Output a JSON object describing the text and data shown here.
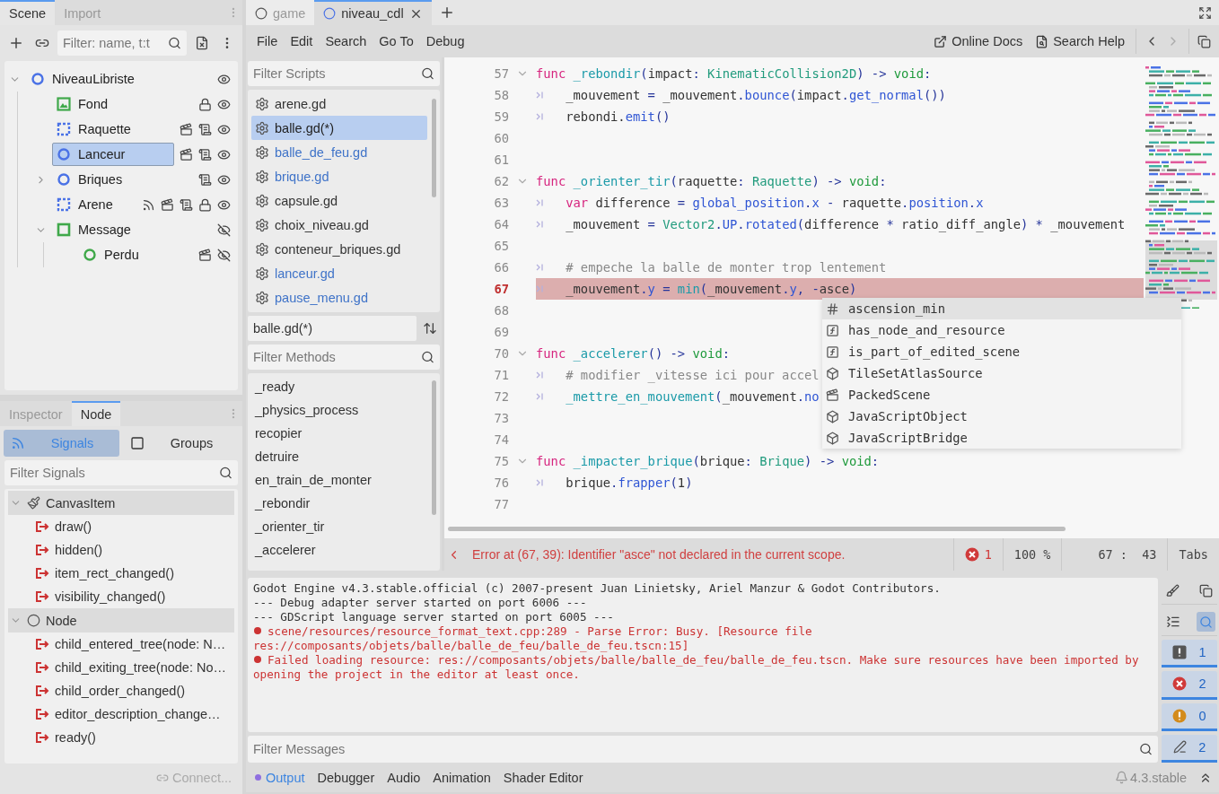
{
  "scene_dock": {
    "tabs": [
      {
        "label": "Scene",
        "selected": true
      },
      {
        "label": "Import",
        "selected": false
      }
    ],
    "filter": {
      "placeholder": "Filter: name, t:t"
    },
    "tree": [
      {
        "name": "NiveauLibriste",
        "kind": "circle",
        "color": "#4a72e6",
        "selected": false,
        "expanded": true,
        "badges": [
          {
            "kind": "visible"
          }
        ],
        "children": [
          {
            "name": "Fond",
            "kind": "image",
            "color": "#3fa84a",
            "selected": false,
            "badges": [
              {
                "kind": "lock"
              },
              {
                "kind": "visible"
              }
            ]
          },
          {
            "name": "Raquette",
            "kind": "dotted-square",
            "color": "#4a72e6",
            "selected": false,
            "badges": [
              {
                "kind": "scene"
              },
              {
                "kind": "script"
              },
              {
                "kind": "visible"
              }
            ]
          },
          {
            "name": "Lanceur",
            "kind": "circle",
            "color": "#4a72e6",
            "selected": true,
            "badges": [
              {
                "kind": "scene"
              },
              {
                "kind": "script"
              },
              {
                "kind": "visible"
              }
            ]
          },
          {
            "name": "Briques",
            "kind": "circle",
            "color": "#4a72e6",
            "selected": false,
            "expanded": false,
            "badges": [
              {
                "kind": "script"
              },
              {
                "kind": "visible"
              }
            ]
          },
          {
            "name": "Arene",
            "kind": "dotted-square",
            "color": "#4a72e6",
            "selected": false,
            "badges": [
              {
                "kind": "signal"
              },
              {
                "kind": "scene"
              },
              {
                "kind": "script"
              },
              {
                "kind": "lock"
              },
              {
                "kind": "visible"
              }
            ]
          },
          {
            "name": "Message",
            "kind": "square",
            "color": "#3fa84a",
            "selected": false,
            "expanded": true,
            "badges": [
              {
                "kind": "hidden"
              }
            ],
            "children": [
              {
                "name": "Perdu",
                "kind": "circle",
                "color": "#3fa84a",
                "selected": false,
                "badges": [
                  {
                    "kind": "scene"
                  },
                  {
                    "kind": "hidden"
                  }
                ]
              }
            ]
          }
        ]
      }
    ]
  },
  "node_dock": {
    "tabs": [
      {
        "label": "Inspector",
        "selected": false
      },
      {
        "label": "Node",
        "selected": true
      }
    ],
    "modes": [
      {
        "kind": "signals",
        "label": "Signals",
        "selected": true
      },
      {
        "kind": "groups",
        "label": "Groups",
        "selected": false
      }
    ],
    "filter": {
      "placeholder": "Filter Signals"
    },
    "groups": [
      {
        "name": "CanvasItem",
        "kind": "brush",
        "expanded": true,
        "signals": [
          "draw()",
          "hidden()",
          "item_rect_changed()",
          "visibility_changed()"
        ]
      },
      {
        "name": "Node",
        "kind": "circle",
        "expanded": true,
        "signals": [
          "child_entered_tree(node: N…",
          "child_exiting_tree(node: No…",
          "child_order_changed()",
          "editor_description_change…",
          "ready()"
        ]
      }
    ],
    "connect": {
      "label": "Connect...",
      "disabled": true
    }
  },
  "editor_tabs": [
    {
      "label": "game",
      "selected": false
    },
    {
      "label": "niveau_cdl",
      "selected": true
    }
  ],
  "menu": [
    "File",
    "Edit",
    "Search",
    "Go To",
    "Debug"
  ],
  "help_buttons": [
    {
      "kind": "docs",
      "label": "Online Docs"
    },
    {
      "kind": "search",
      "label": "Search Help"
    }
  ],
  "scripts_panel": {
    "filter": {
      "placeholder": "Filter Scripts"
    },
    "scripts": [
      {
        "name": "arene.gd",
        "selected": false,
        "color": "#333333"
      },
      {
        "name": "balle.gd(*)",
        "selected": true,
        "color": "#222222"
      },
      {
        "name": "balle_de_feu.gd",
        "selected": false,
        "color": "#3f73c8"
      },
      {
        "name": "brique.gd",
        "selected": false,
        "color": "#3f73c8"
      },
      {
        "name": "capsule.gd",
        "selected": false,
        "color": "#333333"
      },
      {
        "name": "choix_niveau.gd",
        "selected": false,
        "color": "#333333"
      },
      {
        "name": "conteneur_briques.gd",
        "selected": false,
        "color": "#333333"
      },
      {
        "name": "lanceur.gd",
        "selected": false,
        "color": "#3f73c8"
      },
      {
        "name": "pause_menu.gd",
        "selected": false,
        "color": "#3f73c8"
      }
    ],
    "current": "balle.gd(*)",
    "methods_filter": {
      "placeholder": "Filter Methods"
    },
    "methods": [
      "_ready",
      "_physics_process",
      "recopier",
      "detruire",
      "en_train_de_monter",
      "_rebondir",
      "_orienter_tir",
      "_accelerer"
    ]
  },
  "code": {
    "lines": [
      {
        "number": "57",
        "foldable": true,
        "error": false,
        "segments": [
          {
            "kind": "keyword",
            "text": "func "
          },
          {
            "kind": "function",
            "text": "_rebondir"
          },
          {
            "kind": "symbol",
            "text": "("
          },
          {
            "kind": "plain",
            "text": "impact"
          },
          {
            "kind": "symbol",
            "text": ": "
          },
          {
            "kind": "type",
            "text": "KinematicCollision2D"
          },
          {
            "kind": "symbol",
            "text": ") -> "
          },
          {
            "kind": "builtin",
            "text": "void"
          },
          {
            "kind": "symbol",
            "text": ":"
          }
        ]
      },
      {
        "number": "58",
        "foldable": false,
        "error": false,
        "segments": [
          {
            "kind": "tab"
          },
          {
            "kind": "plain",
            "text": "_mouvement "
          },
          {
            "kind": "symbol",
            "text": "= "
          },
          {
            "kind": "plain",
            "text": "_mouvement"
          },
          {
            "kind": "symbol",
            "text": "."
          },
          {
            "kind": "member",
            "text": "bounce"
          },
          {
            "kind": "symbol",
            "text": "("
          },
          {
            "kind": "plain",
            "text": "impact"
          },
          {
            "kind": "symbol",
            "text": "."
          },
          {
            "kind": "member",
            "text": "get_normal"
          },
          {
            "kind": "symbol",
            "text": "())"
          }
        ]
      },
      {
        "number": "59",
        "foldable": false,
        "error": false,
        "segments": [
          {
            "kind": "tab"
          },
          {
            "kind": "plain",
            "text": "rebondi."
          },
          {
            "kind": "member",
            "text": "emit"
          },
          {
            "kind": "symbol",
            "text": "()"
          }
        ]
      },
      {
        "number": "60",
        "foldable": false,
        "error": false
      },
      {
        "number": "61",
        "foldable": false,
        "error": false
      },
      {
        "number": "62",
        "foldable": true,
        "error": false,
        "segments": [
          {
            "kind": "keyword",
            "text": "func "
          },
          {
            "kind": "function",
            "text": "_orienter_tir"
          },
          {
            "kind": "symbol",
            "text": "("
          },
          {
            "kind": "plain",
            "text": "raquette"
          },
          {
            "kind": "symbol",
            "text": ": "
          },
          {
            "kind": "type",
            "text": "Raquette"
          },
          {
            "kind": "symbol",
            "text": ") -> "
          },
          {
            "kind": "builtin",
            "text": "void"
          },
          {
            "kind": "symbol",
            "text": ":"
          }
        ]
      },
      {
        "number": "63",
        "foldable": false,
        "error": false,
        "segments": [
          {
            "kind": "tab"
          },
          {
            "kind": "keyword",
            "text": "var "
          },
          {
            "kind": "plain",
            "text": "difference "
          },
          {
            "kind": "symbol",
            "text": "= "
          },
          {
            "kind": "member",
            "text": "global_position"
          },
          {
            "kind": "symbol",
            "text": "."
          },
          {
            "kind": "member",
            "text": "x"
          },
          {
            "kind": "symbol",
            "text": " - "
          },
          {
            "kind": "plain",
            "text": "raquette"
          },
          {
            "kind": "symbol",
            "text": "."
          },
          {
            "kind": "member",
            "text": "position"
          },
          {
            "kind": "symbol",
            "text": "."
          },
          {
            "kind": "member",
            "text": "x"
          }
        ]
      },
      {
        "number": "64",
        "foldable": false,
        "error": false,
        "segments": [
          {
            "kind": "tab"
          },
          {
            "kind": "plain",
            "text": "_mouvement "
          },
          {
            "kind": "symbol",
            "text": "= "
          },
          {
            "kind": "type",
            "text": "Vector2"
          },
          {
            "kind": "symbol",
            "text": "."
          },
          {
            "kind": "member",
            "text": "UP"
          },
          {
            "kind": "symbol",
            "text": "."
          },
          {
            "kind": "member",
            "text": "rotated"
          },
          {
            "kind": "symbol",
            "text": "("
          },
          {
            "kind": "plain",
            "text": "difference "
          },
          {
            "kind": "symbol",
            "text": "* "
          },
          {
            "kind": "plain",
            "text": "ratio_diff_angle"
          },
          {
            "kind": "symbol",
            "text": ") * "
          },
          {
            "kind": "plain",
            "text": "_mouvement"
          }
        ]
      },
      {
        "number": "65",
        "foldable": false,
        "error": false
      },
      {
        "number": "66",
        "foldable": false,
        "error": false,
        "segments": [
          {
            "kind": "tab"
          },
          {
            "kind": "comment",
            "text": "# empeche la balle de monter trop lentement"
          }
        ]
      },
      {
        "number": "67",
        "foldable": false,
        "error": true,
        "segments": [
          {
            "kind": "tab"
          },
          {
            "kind": "plain",
            "text": "_mouvement"
          },
          {
            "kind": "symbol",
            "text": "."
          },
          {
            "kind": "member",
            "text": "y "
          },
          {
            "kind": "symbol",
            "text": "= "
          },
          {
            "kind": "function",
            "text": "min"
          },
          {
            "kind": "symbol",
            "text": "("
          },
          {
            "kind": "plain",
            "text": "_mouvement"
          },
          {
            "kind": "symbol",
            "text": "."
          },
          {
            "kind": "member",
            "text": "y"
          },
          {
            "kind": "symbol",
            "text": ", -"
          },
          {
            "kind": "plain",
            "text": "asce"
          },
          {
            "kind": "symbol",
            "text": ")"
          }
        ]
      },
      {
        "number": "68",
        "foldable": false,
        "error": false
      },
      {
        "number": "69",
        "foldable": false,
        "error": false
      },
      {
        "number": "70",
        "foldable": true,
        "error": false,
        "segments": [
          {
            "kind": "keyword",
            "text": "func "
          },
          {
            "kind": "function",
            "text": "_accelerer"
          },
          {
            "kind": "symbol",
            "text": "() -> "
          },
          {
            "kind": "builtin",
            "text": "void"
          },
          {
            "kind": "symbol",
            "text": ":"
          }
        ]
      },
      {
        "number": "71",
        "foldable": false,
        "error": false,
        "segments": [
          {
            "kind": "tab"
          },
          {
            "kind": "comment",
            "text": "# modifier _vitesse ici pour accel"
          }
        ]
      },
      {
        "number": "72",
        "foldable": false,
        "error": false,
        "segments": [
          {
            "kind": "tab"
          },
          {
            "kind": "function",
            "text": "_mettre_en_mouvement"
          },
          {
            "kind": "symbol",
            "text": "("
          },
          {
            "kind": "plain",
            "text": "_mouvement"
          },
          {
            "kind": "symbol",
            "text": "."
          },
          {
            "kind": "member",
            "text": "no"
          }
        ]
      },
      {
        "number": "73",
        "foldable": false,
        "error": false
      },
      {
        "number": "74",
        "foldable": false,
        "error": false
      },
      {
        "number": "75",
        "foldable": true,
        "error": false,
        "segments": [
          {
            "kind": "keyword",
            "text": "func "
          },
          {
            "kind": "function",
            "text": "_impacter_brique"
          },
          {
            "kind": "symbol",
            "text": "("
          },
          {
            "kind": "plain",
            "text": "brique"
          },
          {
            "kind": "symbol",
            "text": ": "
          },
          {
            "kind": "type",
            "text": "Brique"
          },
          {
            "kind": "symbol",
            "text": ") -> "
          },
          {
            "kind": "builtin",
            "text": "void"
          },
          {
            "kind": "symbol",
            "text": ":"
          }
        ]
      },
      {
        "number": "76",
        "foldable": false,
        "error": false,
        "segments": [
          {
            "kind": "tab"
          },
          {
            "kind": "plain",
            "text": "brique"
          },
          {
            "kind": "symbol",
            "text": "."
          },
          {
            "kind": "member",
            "text": "frapper"
          },
          {
            "kind": "symbol",
            "text": "("
          },
          {
            "kind": "plain",
            "text": "1"
          },
          {
            "kind": "symbol",
            "text": ")"
          }
        ]
      },
      {
        "number": "77",
        "foldable": false,
        "error": false
      }
    ],
    "completions": [
      {
        "kind": "constant",
        "label": "ascension_min",
        "selected": true
      },
      {
        "kind": "method",
        "label": "has_node_and_resource",
        "selected": false
      },
      {
        "kind": "method",
        "label": "is_part_of_edited_scene",
        "selected": false
      },
      {
        "kind": "class",
        "label": "TileSetAtlasSource",
        "selected": false
      },
      {
        "kind": "scene",
        "label": "PackedScene",
        "selected": false
      },
      {
        "kind": "object",
        "label": "JavaScriptObject",
        "selected": false
      },
      {
        "kind": "object",
        "label": "JavaScriptBridge",
        "selected": false
      }
    ]
  },
  "status_bar": {
    "message": "Error at (67, 39): Identifier \"asce\" not declared in the current scope.",
    "errors": "1",
    "zoom": "100 %",
    "position": "67 :  43",
    "indent": "Tabs"
  },
  "output": {
    "lines": [
      {
        "kind": "plain",
        "text": "Godot Engine v4.3.stable.official (c) 2007-present Juan Linietsky, Ariel Manzur & Godot Contributors."
      },
      {
        "kind": "plain",
        "text": "--- Debug adapter server started on port 6006 ---"
      },
      {
        "kind": "plain",
        "text": "--- GDScript language server started on port 6005 ---"
      },
      {
        "kind": "error",
        "text": "scene/resources/resource_format_text.cpp:289 - Parse Error: Busy. [Resource file res://composants/objets/balle/balle_de_feu/balle_de_feu.tscn:15]"
      },
      {
        "kind": "error",
        "text": "Failed loading resource: res://composants/objets/balle/balle_de_feu/balle_de_feu.tscn. Make sure resources have been imported by opening the project in the editor at least once."
      }
    ],
    "filter": {
      "placeholder": "Filter Messages"
    },
    "search_on": true,
    "toggles": [
      {
        "kind": "message",
        "count": "1",
        "selected": true
      },
      {
        "kind": "error",
        "count": "2",
        "selected": true
      },
      {
        "kind": "warning",
        "count": "0",
        "selected": true
      },
      {
        "kind": "editor",
        "count": "2",
        "selected": true
      }
    ]
  },
  "bottom_tabs": [
    {
      "label": "Output",
      "selected": true
    },
    {
      "label": "Debugger",
      "selected": false
    },
    {
      "label": "Audio",
      "selected": false
    },
    {
      "label": "Animation",
      "selected": false
    },
    {
      "label": "Shader Editor",
      "selected": false
    }
  ],
  "version": "4.3.stable"
}
